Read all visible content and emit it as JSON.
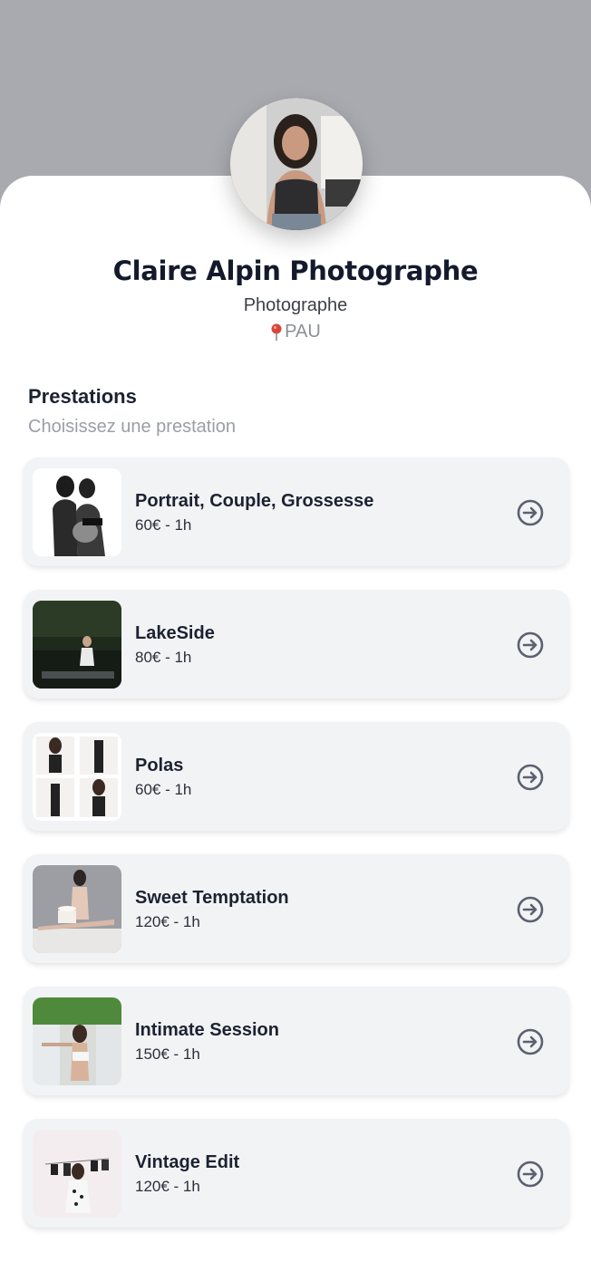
{
  "profile": {
    "name": "Claire Alpin Photographe",
    "role": "Photographe",
    "location": "PAU"
  },
  "section": {
    "title": "Prestations",
    "subtitle": "Choisissez une prestation"
  },
  "services": [
    {
      "title": "Portrait, Couple, Grossesse",
      "price": "60€ - 1h"
    },
    {
      "title": "LakeSide",
      "price": "80€ - 1h"
    },
    {
      "title": "Polas",
      "price": "60€ - 1h"
    },
    {
      "title": "Sweet Temptation",
      "price": "120€ - 1h"
    },
    {
      "title": "Intimate Session",
      "price": "150€ - 1h"
    },
    {
      "title": "Vintage Edit",
      "price": "120€ - 1h"
    }
  ],
  "colors": {
    "banner": "#a9aaaf",
    "card_bg": "#f2f3f5",
    "text_dark": "#1c2232",
    "pin_red": "#d9443a",
    "arrow": "#5b6170"
  },
  "icons": {
    "location": "map-pin-icon",
    "service_action": "arrow-right-circle-icon"
  }
}
